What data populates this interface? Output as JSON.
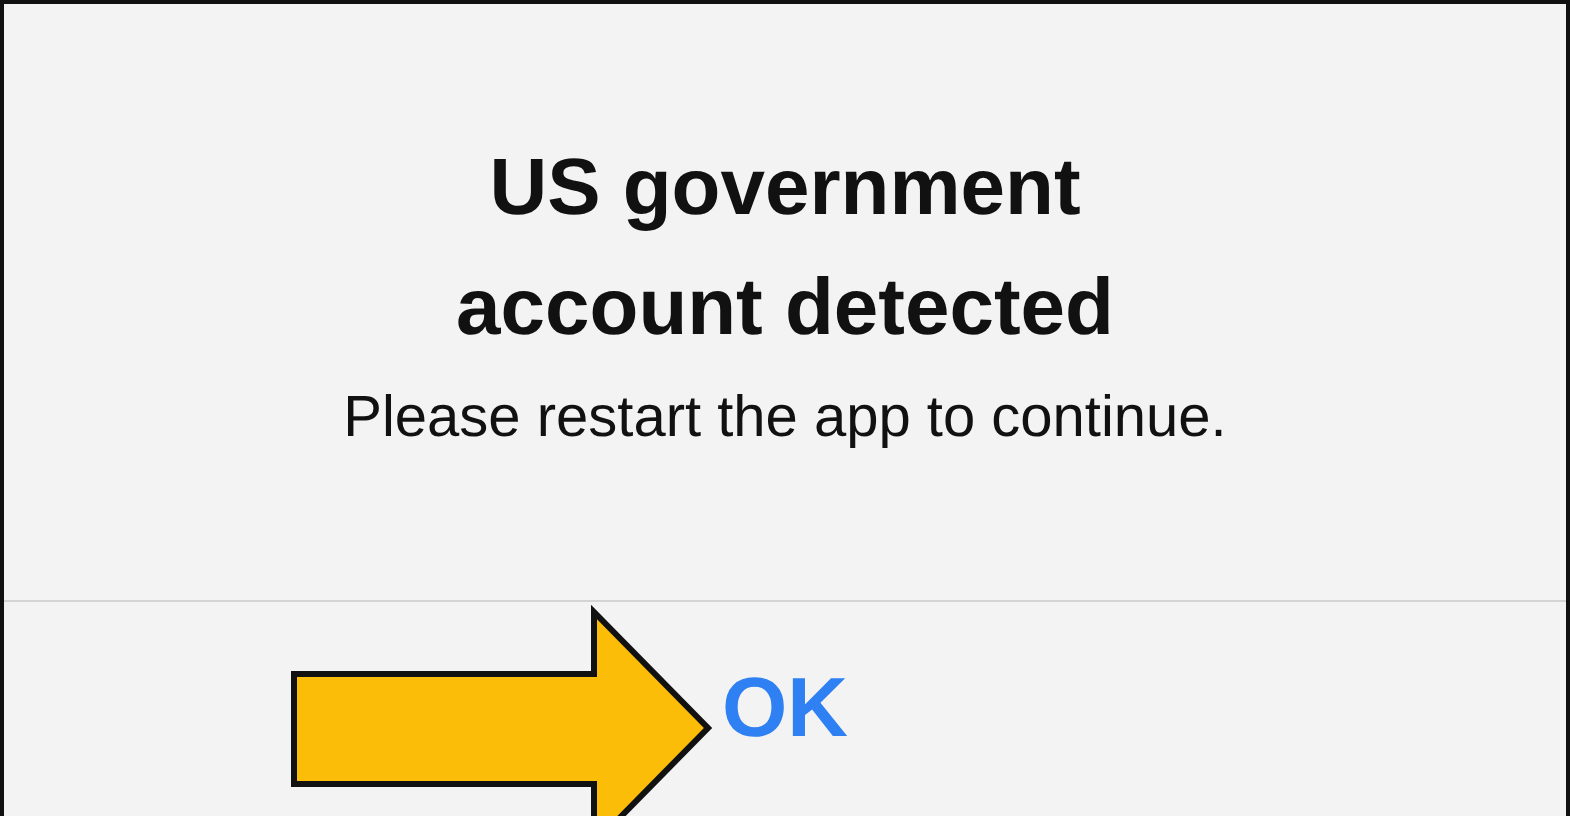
{
  "alert": {
    "title": "US government account detected",
    "message": "Please restart the app to continue.",
    "buttons": [
      {
        "label": "OK"
      }
    ]
  }
}
